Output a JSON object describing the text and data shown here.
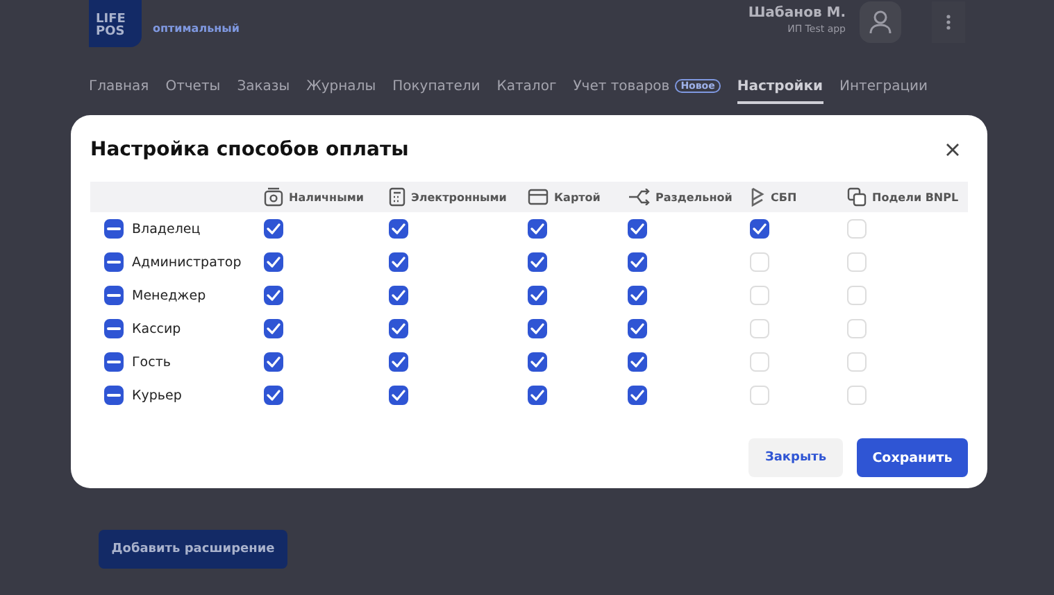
{
  "header": {
    "logo": [
      "LIFE",
      "POS"
    ],
    "plan": "оптимальный",
    "user_name": "Шабанов М.",
    "company": "ИП Test app"
  },
  "nav": [
    {
      "label": "Главная",
      "selected": false
    },
    {
      "label": "Отчеты",
      "selected": false
    },
    {
      "label": "Заказы",
      "selected": false
    },
    {
      "label": "Журналы",
      "selected": false
    },
    {
      "label": "Покупатели",
      "selected": false
    },
    {
      "label": "Каталог",
      "selected": false
    },
    {
      "label": "Учет товаров",
      "badge": "Новое",
      "selected": false
    },
    {
      "label": "Настройки",
      "selected": true
    },
    {
      "label": "Интеграции",
      "selected": false
    }
  ],
  "page_button": "Добавить расширение",
  "dialog": {
    "title": "Настройка способов оплаты",
    "columns": [
      {
        "label": "Наличными",
        "kind": "cash"
      },
      {
        "label": "Электронными",
        "kind": "calculator"
      },
      {
        "label": "Картой",
        "kind": "card"
      },
      {
        "label": "Раздельной",
        "kind": "split"
      },
      {
        "label": "СБП",
        "kind": "sbp"
      },
      {
        "label": "Подели BNPL",
        "kind": "copy"
      }
    ],
    "rows": [
      {
        "role": "Владелец",
        "partial": true,
        "checks": [
          true,
          true,
          true,
          true,
          true,
          false
        ]
      },
      {
        "role": "Администратор",
        "partial": true,
        "checks": [
          true,
          true,
          true,
          true,
          false,
          false
        ]
      },
      {
        "role": "Менеджер",
        "partial": true,
        "checks": [
          true,
          true,
          true,
          true,
          false,
          false
        ]
      },
      {
        "role": "Кассир",
        "partial": true,
        "checks": [
          true,
          true,
          true,
          true,
          false,
          false
        ]
      },
      {
        "role": "Гость",
        "partial": true,
        "checks": [
          true,
          true,
          true,
          true,
          false,
          false
        ]
      },
      {
        "role": "Курьер",
        "partial": true,
        "checks": [
          true,
          true,
          true,
          true,
          false,
          false
        ]
      }
    ],
    "buttons": {
      "close": "Закрыть",
      "save": "Сохранить"
    }
  }
}
